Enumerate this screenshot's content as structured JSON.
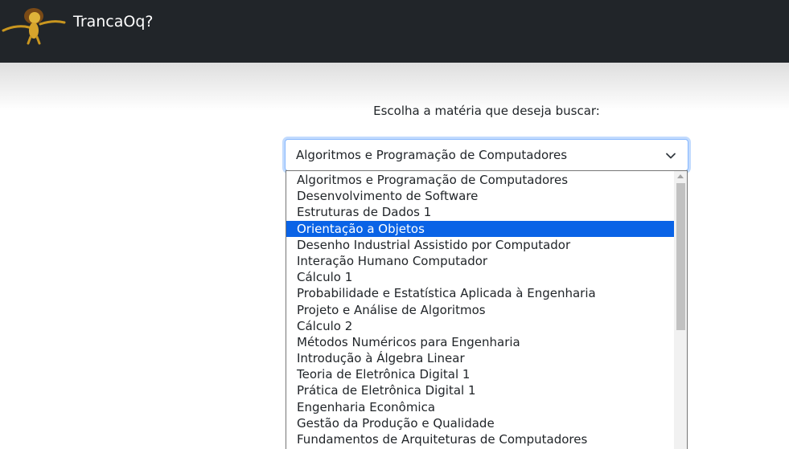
{
  "navbar": {
    "brand": "TrancaOq?",
    "logo_icon": "lion-mascot-icon"
  },
  "main": {
    "prompt": "Escolha a matéria que deseja buscar:",
    "select": {
      "value": "Algoritmos e Programação de Computadores",
      "chevron_icon": "chevron-down-icon"
    },
    "options": [
      "Algoritmos e Programação de Computadores",
      "Desenvolvimento de Software",
      "Estruturas de Dados 1",
      "Orientação a Objetos",
      "Desenho Industrial Assistido por Computador",
      "Interação Humano Computador",
      "Cálculo 1",
      "Probabilidade e Estatística Aplicada à Engenharia",
      "Projeto e Análise de Algoritmos",
      "Cálculo 2",
      "Métodos Numéricos para Engenharia",
      "Introdução à Álgebra Linear",
      "Teoria de Eletrônica Digital 1",
      "Prática de Eletrônica Digital 1",
      "Engenharia Econômica",
      "Gestão da Produção e Qualidade",
      "Fundamentos de Arquiteturas de Computadores"
    ],
    "highlighted_option": "Orientação a Objetos"
  },
  "colors": {
    "navbar_bg": "#212529",
    "highlight": "#0a63e6",
    "focus_ring": "#86b7fe"
  }
}
